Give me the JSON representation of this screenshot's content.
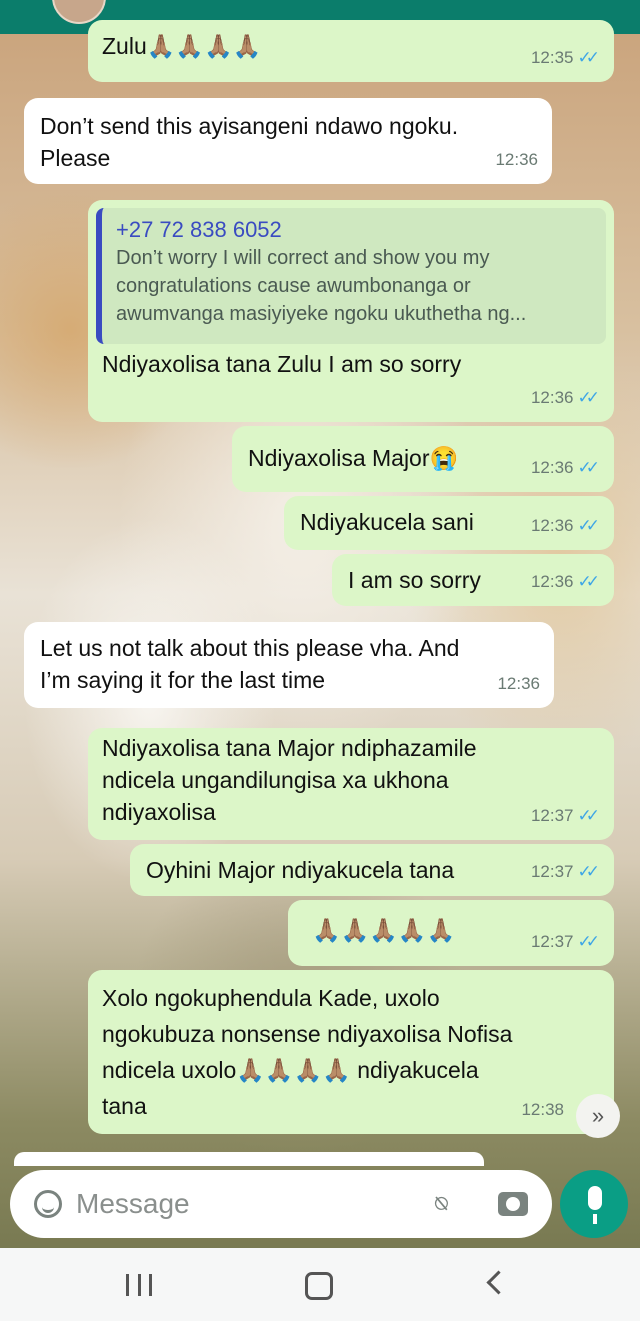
{
  "messages": [
    {
      "side": "out",
      "text": "Zulu🙏🏽🙏🏽🙏🏽🙏🏽",
      "time": "12:35",
      "ticks": "✓✓"
    },
    {
      "side": "in",
      "text": "Don’t send this ayisangeni ndawo ngoku.\nPlease",
      "time": "12:36"
    },
    {
      "side": "out",
      "quote_name": "+27 72 838 6052",
      "quote_text": "Don’t worry I will correct and show you my\ncongratulations cause awumbonanga or\nawumvanga masiyiyeke ngoku ukuthetha ng...",
      "text": "Ndiyaxolisa tana Zulu I am so sorry",
      "time": "12:36",
      "ticks": "✓✓"
    },
    {
      "side": "out",
      "text": "Ndiyaxolisa Major😭",
      "time": "12:36",
      "ticks": "✓✓"
    },
    {
      "side": "out",
      "text": "Ndiyakucela sani",
      "time": "12:36",
      "ticks": "✓✓"
    },
    {
      "side": "out",
      "text": "I am so sorry",
      "time": "12:36",
      "ticks": "✓✓"
    },
    {
      "side": "in",
      "text": "Let us not talk about this please vha. And\nI’m saying it for the last time",
      "time": "12:36"
    },
    {
      "side": "out",
      "text": "Ndiyaxolisa tana Major ndiphazamile\nndicela ungandilungisa xa ukhona\nndiyaxolisa",
      "time": "12:37",
      "ticks": "✓✓"
    },
    {
      "side": "out",
      "text": "Oyhini Major ndiyakucela tana",
      "time": "12:37",
      "ticks": "✓✓"
    },
    {
      "side": "out",
      "text": "🙏🏽🙏🏽🙏🏽🙏🏽🙏🏽",
      "time": "12:37",
      "ticks": "✓✓"
    },
    {
      "side": "out",
      "text": "Xolo ngokuphendula Kade, uxolo\nngokubuza nonsense ndiyaxolisa Nofisa\nndicela uxolo🙏🏽🙏🏽🙏🏽🙏🏽 ndiyakucela\ntana",
      "time": "12:38"
    }
  ],
  "input": {
    "placeholder": "Message"
  },
  "icons": {
    "emoji": "emoji-icon",
    "attach": "paperclip-icon",
    "camera": "camera-icon",
    "mic": "mic-icon",
    "scroll": "scroll-down-icon"
  },
  "colors": {
    "header": "#0b7d6b",
    "outgoing": "#dcf6c8",
    "incoming": "#ffffff",
    "ticks": "#3fa6e6",
    "mic": "#0a9e85"
  }
}
